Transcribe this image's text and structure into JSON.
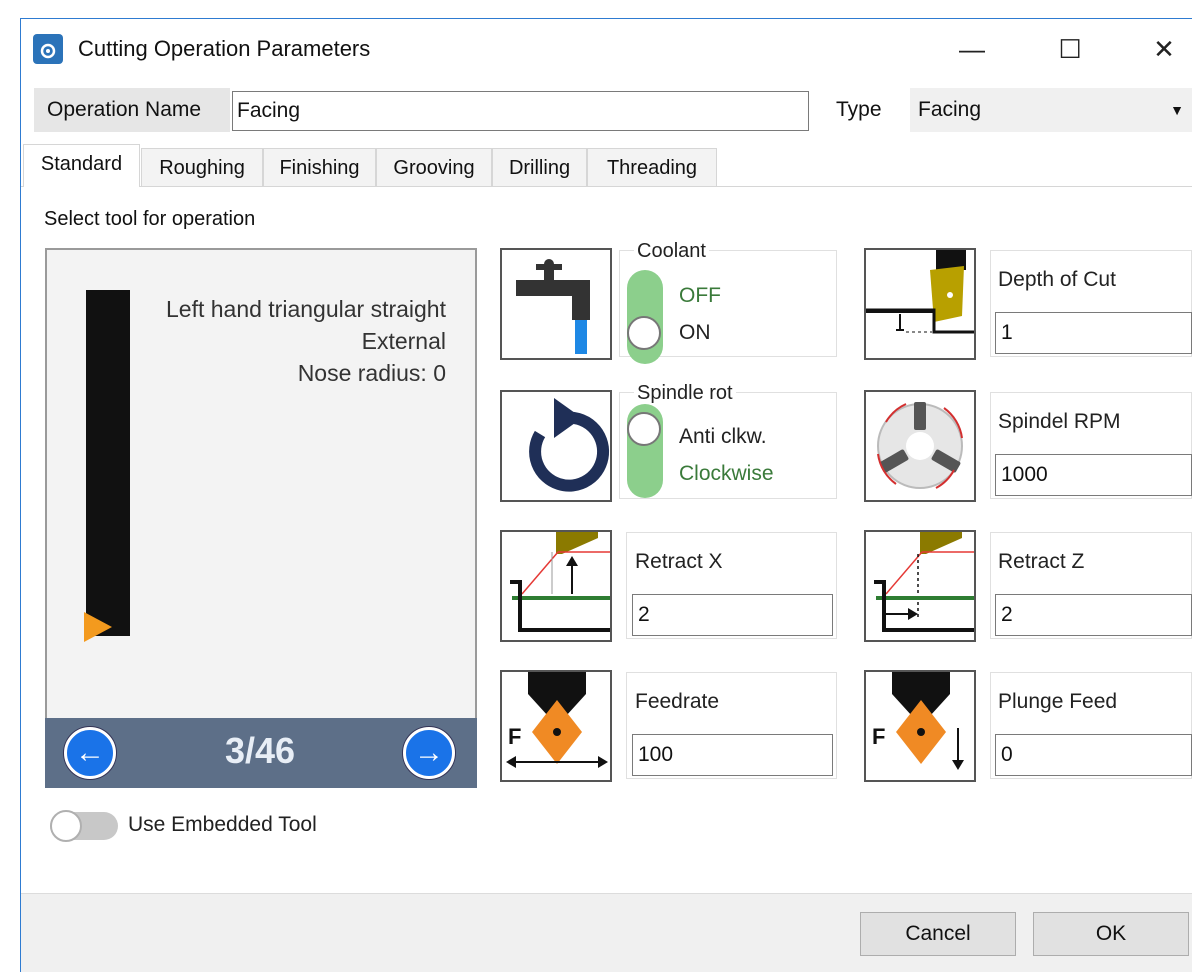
{
  "window": {
    "title": "Cutting Operation Parameters",
    "minimize": "—",
    "maximize": "☐",
    "close": "✕"
  },
  "operation": {
    "name_label": "Operation Name",
    "name_value": "Facing",
    "type_label": "Type",
    "type_value": "Facing"
  },
  "tabs": [
    "Standard",
    "Roughing",
    "Finishing",
    "Grooving",
    "Drilling",
    "Threading"
  ],
  "active_tab": "Standard",
  "tool": {
    "select_label": "Select tool for operation",
    "description_line1": "Left hand triangular straight",
    "description_line2": "External",
    "description_line3": "Nose radius: 0",
    "page_counter": "3/46",
    "embedded_label": "Use Embedded Tool"
  },
  "coolant": {
    "title": "Coolant",
    "off": "OFF",
    "on": "ON",
    "selected": "ON"
  },
  "spindle_rot": {
    "title": "Spindle rot",
    "anti": "Anti clkw.",
    "clockwise": "Clockwise",
    "selected": "Anti clkw."
  },
  "params": {
    "depth_of_cut": {
      "label": "Depth of Cut",
      "value": "1"
    },
    "spindle_rpm": {
      "label": "Spindel RPM",
      "value": "1000"
    },
    "retract_x": {
      "label": "Retract X",
      "value": "2"
    },
    "retract_z": {
      "label": "Retract Z",
      "value": "2"
    },
    "feedrate": {
      "label": "Feedrate",
      "value": "100"
    },
    "plunge_feed": {
      "label": "Plunge Feed",
      "value": "0"
    }
  },
  "icons": {
    "tap": "coolant-tap-icon",
    "rotation": "spindle-rotation-icon",
    "depth": "depth-of-cut-icon",
    "chuck": "chuck-rpm-icon",
    "retract_x": "retract-x-icon",
    "retract_z": "retract-z-icon",
    "feedrate": "feedrate-icon",
    "plunge": "plunge-feed-icon"
  },
  "buttons": {
    "cancel": "Cancel",
    "ok": "OK"
  },
  "colors": {
    "accent": "#2e7bd1",
    "switch_green": "#8ccf8c",
    "insert_orange": "#f08a24",
    "nav_bar": "#5d6f88",
    "nav_button": "#1a73e8"
  }
}
